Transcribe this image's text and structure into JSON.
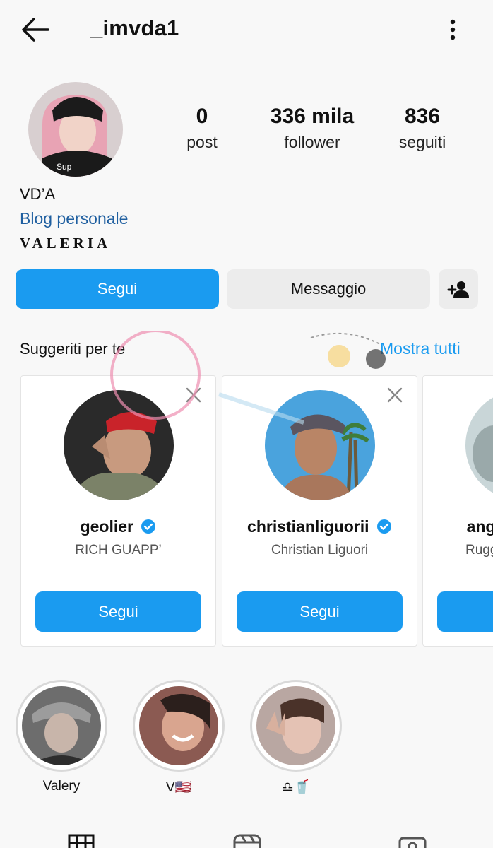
{
  "header": {
    "username": "_imvda1",
    "back_icon": "arrow-left-icon",
    "more_icon": "more-vertical-icon"
  },
  "profile": {
    "stats": [
      {
        "value": "0",
        "label": "post"
      },
      {
        "value": "336 mila",
        "label": "follower"
      },
      {
        "value": "836",
        "label": "seguiti"
      }
    ],
    "name": "VD’A",
    "category": "Blog personale",
    "bio": "VALERIA"
  },
  "actions": {
    "follow": "Segui",
    "message": "Messaggio",
    "add_user_icon": "person-add-icon"
  },
  "suggestions": {
    "title": "Suggeriti per te",
    "see_all": "Mostra tutti",
    "cards": [
      {
        "username": "geolier",
        "verified": true,
        "subtitle": "RICH GUAPP’",
        "button": "Segui"
      },
      {
        "username": "christianliguorii",
        "verified": true,
        "subtitle": "Christian Liguori",
        "button": "Segui"
      },
      {
        "username": "__ang",
        "verified": false,
        "subtitle": "Rugg",
        "button": ""
      }
    ]
  },
  "highlights": [
    {
      "label": "Valery"
    },
    {
      "label": "V🇺🇸"
    },
    {
      "label": "♎🥤"
    }
  ],
  "tabs": [
    "grid-icon",
    "reels-icon",
    "tagged-icon"
  ],
  "colors": {
    "accent": "#1a9bf0",
    "link": "#1f5fa0",
    "button_secondary": "#ececec",
    "background": "#f8f8f8"
  }
}
